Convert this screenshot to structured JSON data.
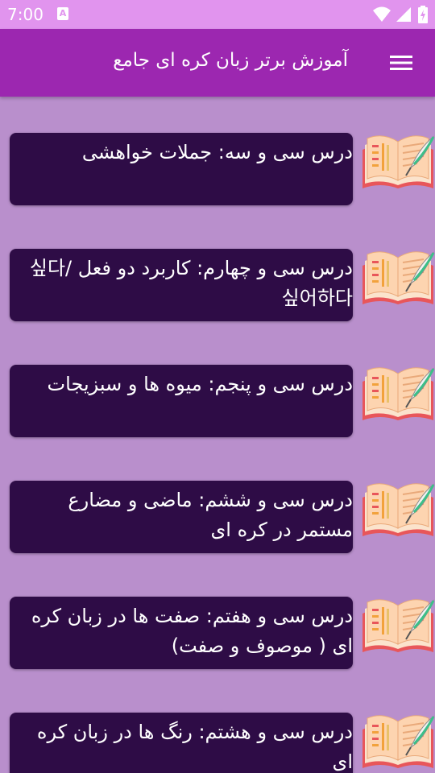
{
  "status_bar": {
    "time": "7:00",
    "notification_letter": "A",
    "icons": [
      "wifi-icon",
      "signal-icon",
      "battery-charging-icon"
    ]
  },
  "app_bar": {
    "title": "آموزش برتر زبان کره ای جامع",
    "menu_icon": "hamburger-menu-icon",
    "color": "#9c27b0"
  },
  "lessons": [
    {
      "title": "درس سی و سه: جملات خواهشی",
      "icon": "open-book-quill-icon"
    },
    {
      "title": "درس سی و چهارم: کاربرد دو فعل 싶다/ 싶어하다",
      "icon": "open-book-quill-icon"
    },
    {
      "title": "درس سی و پنجم: میوه ها و سبزیجات",
      "icon": "open-book-quill-icon"
    },
    {
      "title": "درس سی و ششم: ماضی و مضارع مستمر در کره ای",
      "icon": "open-book-quill-icon"
    },
    {
      "title": "درس سی و هفتم: صفت ها در زبان کره ای ( موصوف و صفت)",
      "icon": "open-book-quill-icon"
    },
    {
      "title": "درس سی و هشتم: رنگ ها در زبان کره ای",
      "icon": "open-book-quill-icon"
    }
  ],
  "colors": {
    "status_bar": "#e194ee",
    "background": "#b98fcc",
    "card": "#2e0c46"
  }
}
